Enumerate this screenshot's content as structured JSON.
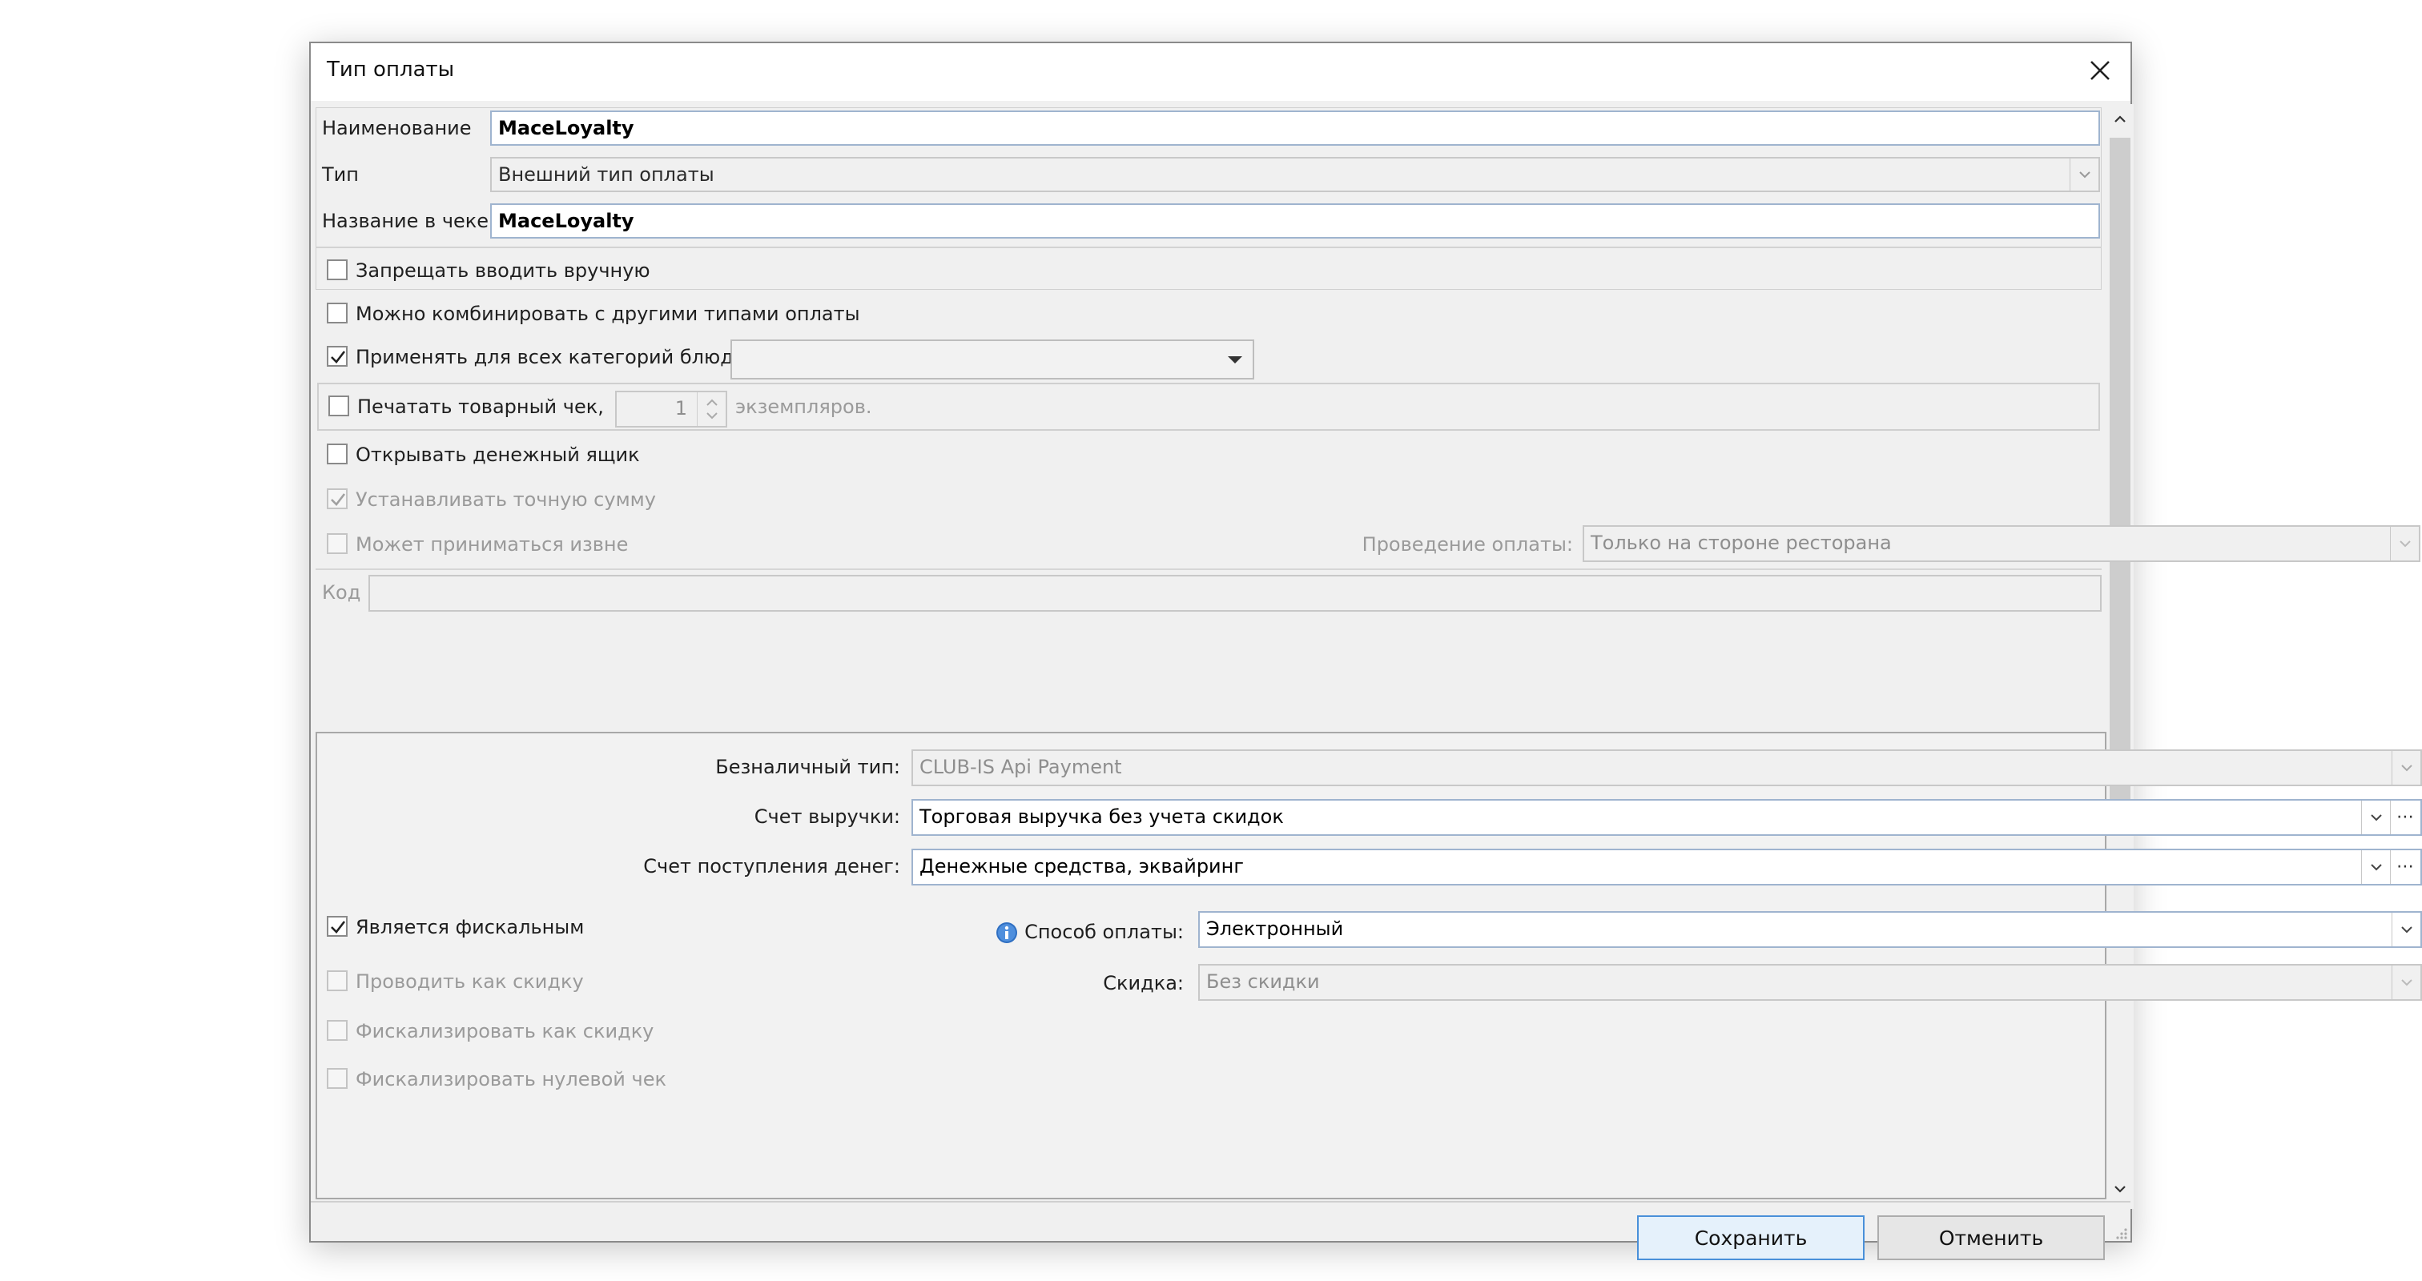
{
  "dialog": {
    "title": "Тип оплаты"
  },
  "fields": {
    "name_label": "Наименование",
    "name_value": "MaceLoyalty",
    "type_label": "Тип",
    "type_value": "Внешний тип оплаты",
    "receipt_name_label": "Название в чеке",
    "receipt_name_value": "MaceLoyalty"
  },
  "options": {
    "forbid_manual": "Запрещать вводить вручную",
    "combine": "Можно комбинировать с другими типами оплаты",
    "apply_all_categories": "Применять для всех категорий блюд",
    "print_receipt": "Печатать товарный чек,",
    "copies_value": "1",
    "copies_suffix": "экземпляров.",
    "open_drawer": "Открывать денежный ящик",
    "exact_sum": "Устанавливать точную сумму",
    "external": "Может приниматься извне",
    "processing_label": "Проведение оплаты:",
    "processing_value": "Только на стороне ресторана",
    "code_label": "Код"
  },
  "noncash": {
    "type_label": "Безналичный тип:",
    "type_value": "CLUB-IS Api Payment",
    "revenue_label": "Счет выручки:",
    "revenue_value": "Торговая выручка без учета скидок",
    "income_label": "Счет поступления денег:",
    "income_value": "Денежные средства, эквайринг",
    "fiscal": "Является фискальным",
    "method_label": "Способ оплаты:",
    "method_value": "Электронный",
    "as_discount": "Проводить как скидку",
    "discount_label": "Скидка:",
    "discount_value": "Без скидки",
    "fiscal_as_discount": "Фискализировать как скидку",
    "fiscal_zero": "Фискализировать нулевой чек"
  },
  "buttons": {
    "save": "Сохранить",
    "cancel": "Отменить"
  },
  "colors": {
    "input_border": "#9fb4cf",
    "primary_border": "#4a90d9",
    "dialog_bg": "#f0f0f0"
  }
}
